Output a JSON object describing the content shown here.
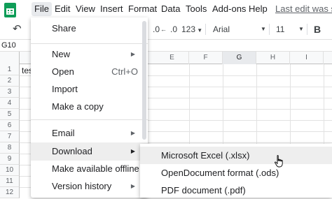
{
  "menubar": {
    "items": [
      "File",
      "Edit",
      "View",
      "Insert",
      "Format",
      "Data",
      "Tools",
      "Add-ons",
      "Help"
    ],
    "last_edit": "Last edit was se"
  },
  "toolbar": {
    "decimal": ".0",
    "number_format": "123",
    "font": "Arial",
    "font_size": "11",
    "bold": "B"
  },
  "formula_bar": {
    "name_box": "G10"
  },
  "grid": {
    "columns": [
      "E",
      "F",
      "G",
      "H",
      "I"
    ],
    "selected_column": "G",
    "rows": [
      "1",
      "2",
      "3",
      "4",
      "5",
      "6",
      "7",
      "8",
      "9",
      "10",
      "11",
      "12"
    ],
    "cell_a1": "tes"
  },
  "file_menu": {
    "items": [
      {
        "label": "Share",
        "shortcut": "",
        "arrow": false
      },
      {
        "label": "New",
        "shortcut": "",
        "arrow": true
      },
      {
        "label": "Open",
        "shortcut": "Ctrl+O",
        "arrow": false
      },
      {
        "label": "Import",
        "shortcut": "",
        "arrow": false
      },
      {
        "label": "Make a copy",
        "shortcut": "",
        "arrow": false
      },
      {
        "label": "Email",
        "shortcut": "",
        "arrow": true
      },
      {
        "label": "Download",
        "shortcut": "",
        "arrow": true
      },
      {
        "label": "Make available offline",
        "shortcut": "",
        "arrow": false
      },
      {
        "label": "Version history",
        "shortcut": "",
        "arrow": true
      }
    ]
  },
  "download_submenu": {
    "items": [
      "Microsoft Excel (.xlsx)",
      "OpenDocument format (.ods)",
      "PDF document (.pdf)"
    ]
  },
  "colors": {
    "sheets_green": "#0f9d58",
    "hover_bg": "#eeeeee",
    "header_bg": "#f8f9fa"
  }
}
